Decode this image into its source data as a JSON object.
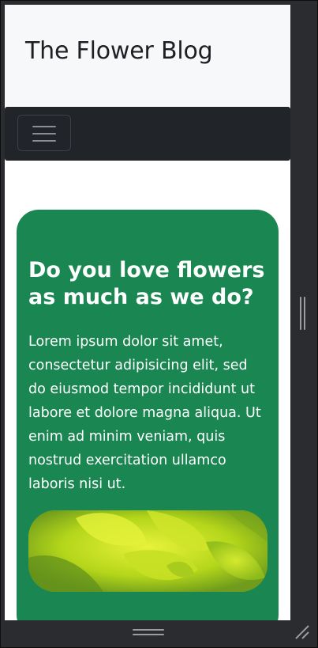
{
  "header": {
    "title": "The Flower Blog"
  },
  "navbar": {
    "toggler_icon": "hamburger-icon"
  },
  "hero": {
    "heading": "Do you love flowers as much as we do?",
    "body": "Lorem ipsum dolor sit amet, consectetur adipisicing elit, sed do eiusmod tempor incididunt ut labore et dolore magna aliqua. Ut enim ad minim veniam, quis nostrud exercitation ullamco laboris nisi ut.",
    "image": "flower-photo"
  },
  "colors": {
    "hero_background": "#1a8652",
    "navbar_background": "#212429",
    "header_background": "#f7f8fa",
    "devtools_chrome": "#2b2c2f"
  },
  "chrome": {
    "vertical_handle_icon": "vertical-resize-grip-icon",
    "horizontal_handle_icon": "horizontal-resize-grip-icon",
    "corner_icon": "resize-corner-icon"
  }
}
